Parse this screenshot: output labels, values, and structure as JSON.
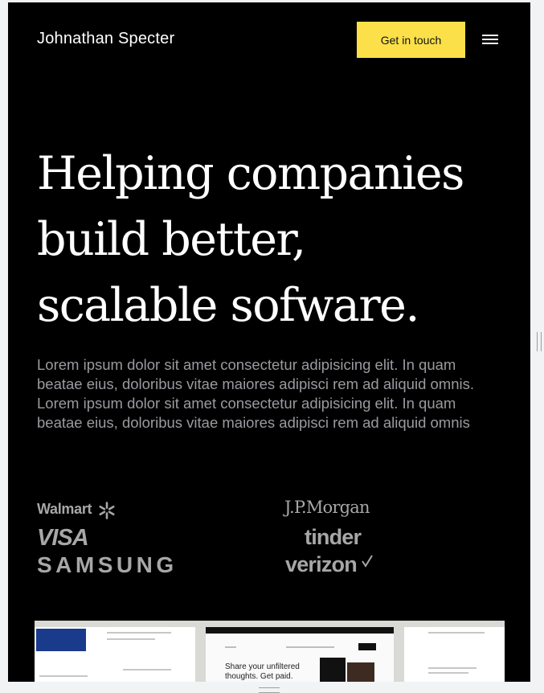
{
  "header": {
    "brand": "Johnathan Specter",
    "cta_label": "Get in touch",
    "menu_icon": "hamburger-menu-icon"
  },
  "hero": {
    "title_line1": "Helping companies",
    "title_line2": "build better,",
    "title_line3": "scalable sofware.",
    "description": "Lorem ipsum dolor sit amet consectetur adipisicing elit. In quam beatae eius, doloribus vitae maiores adipisci rem ad aliquid omnis. Lorem ipsum dolor sit amet consectetur adipisicing elit. In quam beatae eius, doloribus vitae maiores adipisci rem ad aliquid omnis"
  },
  "logos": {
    "walmart": "Walmart",
    "visa": "VISA",
    "samsung": "SAMSUNG",
    "jpmorgan": "J.P.Morgan",
    "tinder": "tinder",
    "verizon": "verizon"
  },
  "preview": {
    "headline": "Share your unfiltered thoughts. Get paid."
  },
  "colors": {
    "background": "#000000",
    "accent": "#fbe04a",
    "text_primary": "#ffffff",
    "text_muted": "#9a9aa0",
    "logo_gray": "#a7a7a7"
  }
}
